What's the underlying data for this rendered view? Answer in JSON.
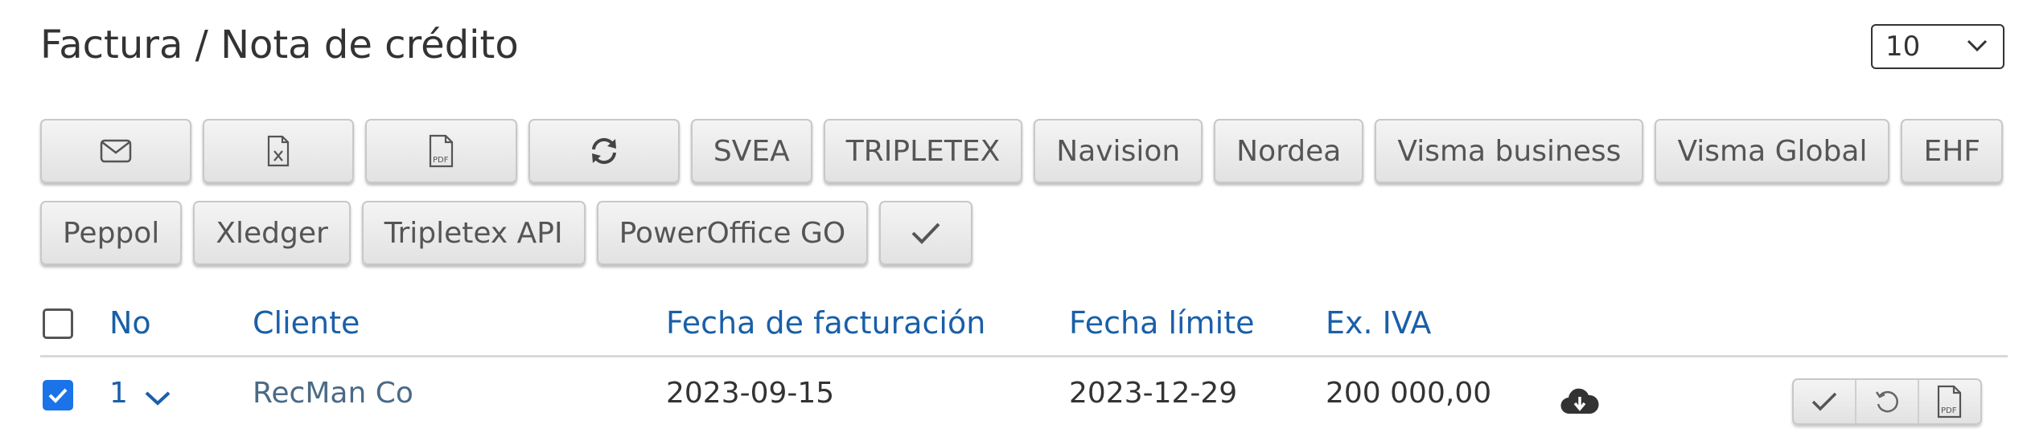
{
  "header": {
    "title": "Factura / Nota de crédito",
    "per_page": "10"
  },
  "toolbar": {
    "row1": [
      "SVEA",
      "TRIPLETEX",
      "Navision",
      "Nordea",
      "Visma business",
      "Visma Global",
      "EHF"
    ],
    "row2": [
      "Peppol",
      "Xledger",
      "Tripletex API",
      "PowerOffice GO"
    ],
    "icons": [
      "envelope-icon",
      "excel-file-icon",
      "pdf-file-icon",
      "refresh-icon",
      "check-icon"
    ]
  },
  "table": {
    "headers": {
      "no": "No",
      "cliente": "Cliente",
      "fecha_facturacion": "Fecha de facturación",
      "fecha_limite": "Fecha límite",
      "ex_iva": "Ex. IVA"
    },
    "rows": [
      {
        "no": "1",
        "cliente": "RecMan Co",
        "fecha_facturacion": "2023-09-15",
        "fecha_limite": "2023-12-29",
        "ex_iva": "200 000,00",
        "checked": true
      }
    ]
  },
  "colors": {
    "accent": "#1a5fa8",
    "checkbox": "#1a73e8"
  }
}
